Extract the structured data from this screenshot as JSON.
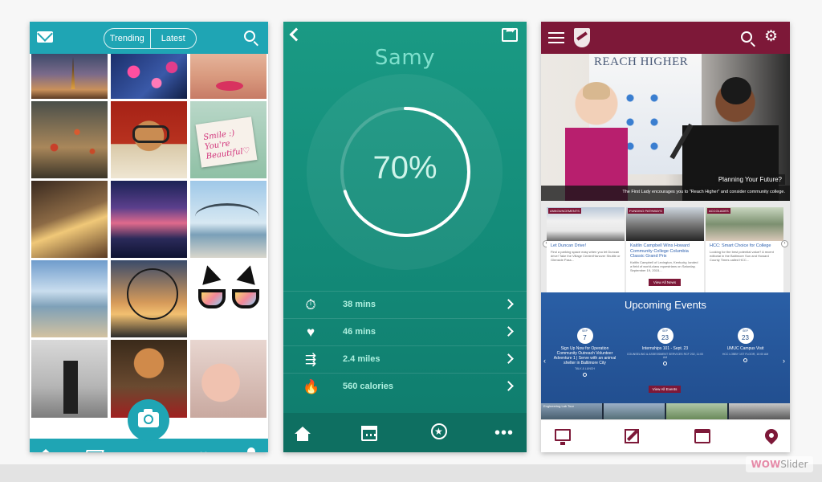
{
  "feed_app": {
    "tabs": [
      "Trending",
      "Latest"
    ],
    "accent": "#1fa5b4",
    "tile_6_caption": [
      "Smile :)",
      "You're",
      "Beautiful♡"
    ],
    "icons": [
      "mail-icon",
      "search-icon",
      "home-icon",
      "map-icon",
      "camera-icon",
      "heart-icon",
      "user-icon"
    ]
  },
  "fitness_app": {
    "name": "Samy",
    "progress_label": "70%",
    "progress": 0.7,
    "stats": [
      {
        "icon": "stopwatch-icon",
        "glyph": "⏱",
        "value": "38 mins"
      },
      {
        "icon": "heart-rate-icon",
        "glyph": "♥",
        "value": "46 mins"
      },
      {
        "icon": "running-icon",
        "glyph": "⇶",
        "value": "2.4 miles"
      },
      {
        "icon": "flame-icon",
        "glyph": "🔥",
        "value": "560 calories"
      }
    ],
    "accent": "#1a9a84"
  },
  "college_app": {
    "accent": "#7d1838",
    "hero_banner": "REACH HIGHER",
    "hero_title": "Planning Your Future?",
    "hero_subtitle": "The First Lady encourages you to \"Reach Higher\" and consider community college.",
    "news": [
      {
        "tag": "ANNOUNCEMENTS",
        "title": "Let Duncan Drive!",
        "body": "Find a parking space easy when you let Duncan drive! Take the Village Center/Hanover Shuttle or Glenside Pass..."
      },
      {
        "tag": "FUNDING PATHWAYS",
        "title": "Kaitlin Campbell Wins Howard Community College Columbia Classic Grand Prix",
        "body": "Kaitlin Campbell of Lexington, Kentucky, landed a field of world-class equestrians on Saturday, September 19, 2015..."
      },
      {
        "tag": "ACCOLADES",
        "title": "HCC: Smart Choice for College",
        "body": "Looking for the best potential value? A recent editorial in the Baltimore Sun and Howard County Times called HCC..."
      }
    ],
    "news_button": "View All News",
    "events_title": "Upcoming Events",
    "events": [
      {
        "month": "SEP",
        "day": "7",
        "title": "Sign Up Now for Operation Community Outreach Volunteer Adventure 1 | Serve with an animal shelter in Baltimore City",
        "loc": "TALK & LUNCH"
      },
      {
        "month": "SEP",
        "day": "23",
        "title": "Internships 101 - Sept. 23",
        "loc": "COUNSELING & ASSESSMENT SERVICES RCF 202, 11:00 AM"
      },
      {
        "month": "SEP",
        "day": "23",
        "title": "UMUC Campus Visit",
        "loc": "HCC LOBBY 1ST FLOOR, 10:00 AM"
      }
    ],
    "events_button": "View All Events",
    "strip": [
      "Engineering Lab Tour",
      "",
      "",
      ""
    ]
  },
  "watermark": {
    "a": "WOW",
    "b": "Slider"
  }
}
